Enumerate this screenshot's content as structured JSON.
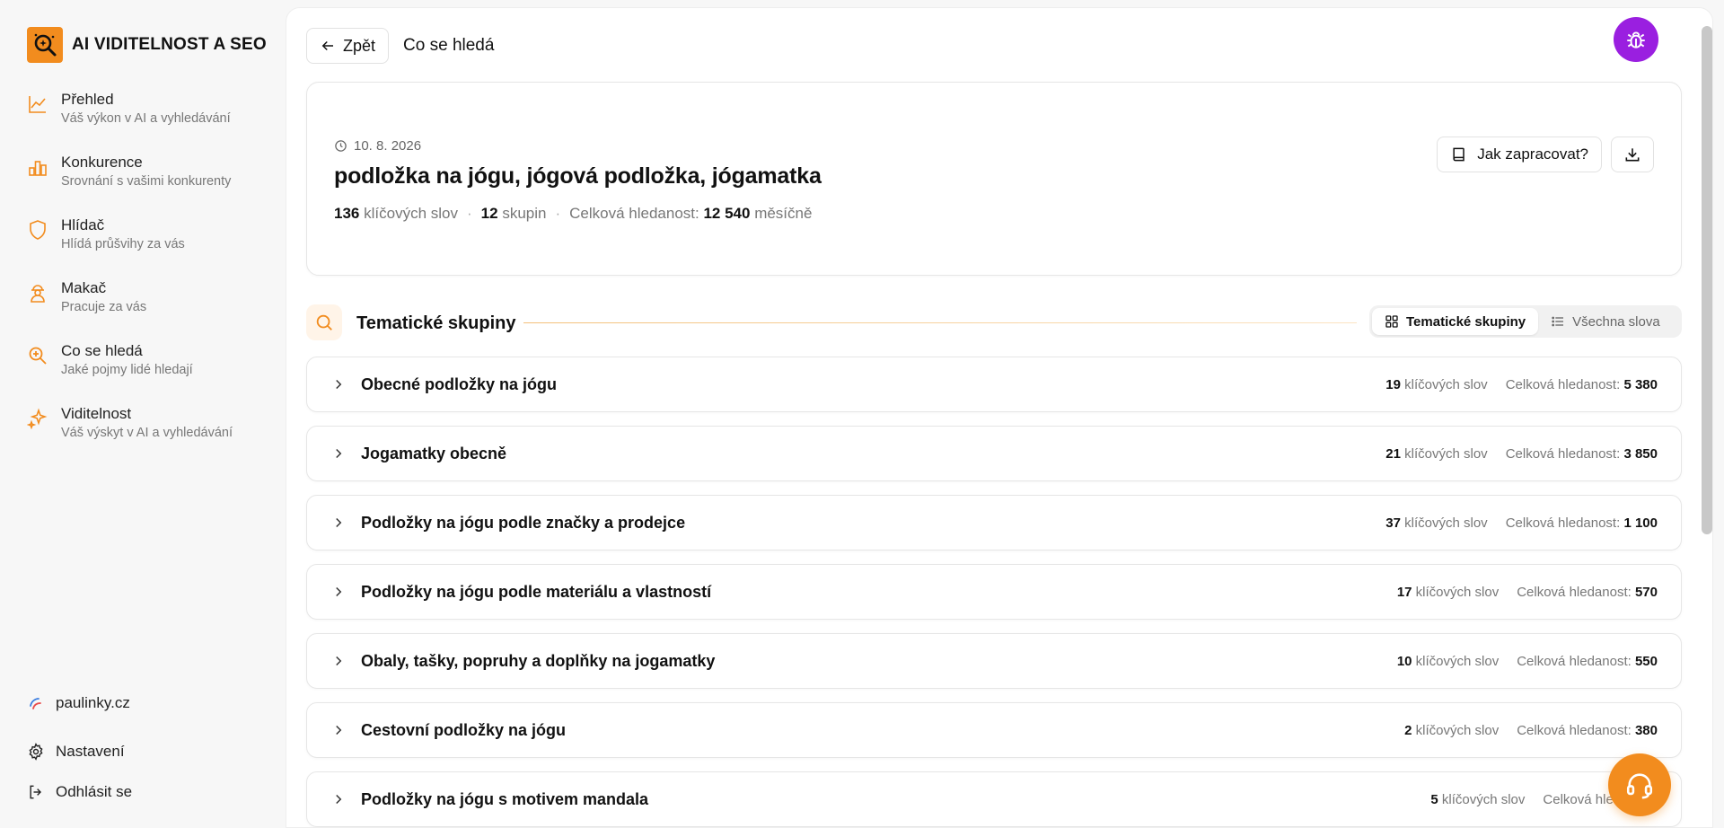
{
  "brand": {
    "name": "AI VIDITELNOST A SEO",
    "accent": "#f28c1e"
  },
  "sidebar": {
    "items": [
      {
        "title": "Přehled",
        "sub": "Váš výkon v AI a vyhledávání",
        "icon": "chart-line-icon"
      },
      {
        "title": "Konkurence",
        "sub": "Srovnání s vašimi konkurenty",
        "icon": "bar-chart-icon"
      },
      {
        "title": "Hlídač",
        "sub": "Hlídá průšvihy za vás",
        "icon": "shield-icon"
      },
      {
        "title": "Makač",
        "sub": "Pracuje za vás",
        "icon": "worker-icon"
      },
      {
        "title": "Co se hledá",
        "sub": "Jaké pojmy lidé hledají",
        "icon": "search-icon"
      },
      {
        "title": "Viditelnost",
        "sub": "Váš výskyt v AI a vyhledávání",
        "icon": "sparkle-icon"
      }
    ],
    "site": "paulinky.cz",
    "settings": "Nastavení",
    "logout": "Odhlásit se"
  },
  "header": {
    "back_label": "Zpět",
    "title": "Co se hledá"
  },
  "hero": {
    "date": "10. 8. 2026",
    "title": "podložka na jógu, jógová podložka, jógamatka",
    "keywords_count": "136",
    "keywords_label": "klíčových slov",
    "groups_count": "12",
    "groups_label": "skupin",
    "total_label": "Celková hledanost:",
    "total_value": "12 540",
    "total_unit": "měsíčně",
    "how_label": "Jak zapracovat?"
  },
  "section": {
    "title": "Tematické skupiny",
    "toggle_groups": "Tematické skupiny",
    "toggle_all": "Všechna slova"
  },
  "groups": [
    {
      "name": "Obecné podložky na jógu",
      "count": "19",
      "total": "5 380"
    },
    {
      "name": "Jogamatky obecně",
      "count": "21",
      "total": "3 850"
    },
    {
      "name": "Podložky na jógu podle značky a prodejce",
      "count": "37",
      "total": "1 100"
    },
    {
      "name": "Podložky na jógu podle materiálu a vlastností",
      "count": "17",
      "total": "570"
    },
    {
      "name": "Obaly, tašky, popruhy a doplňky na jogamatky",
      "count": "10",
      "total": "550"
    },
    {
      "name": "Cestovní podložky na jógu",
      "count": "2",
      "total": "380"
    },
    {
      "name": "Podložky na jógu s motivem mandala",
      "count": "5",
      "total": ""
    }
  ],
  "group_labels": {
    "keywords": "klíčových slov",
    "total": "Celková hledanost:"
  }
}
